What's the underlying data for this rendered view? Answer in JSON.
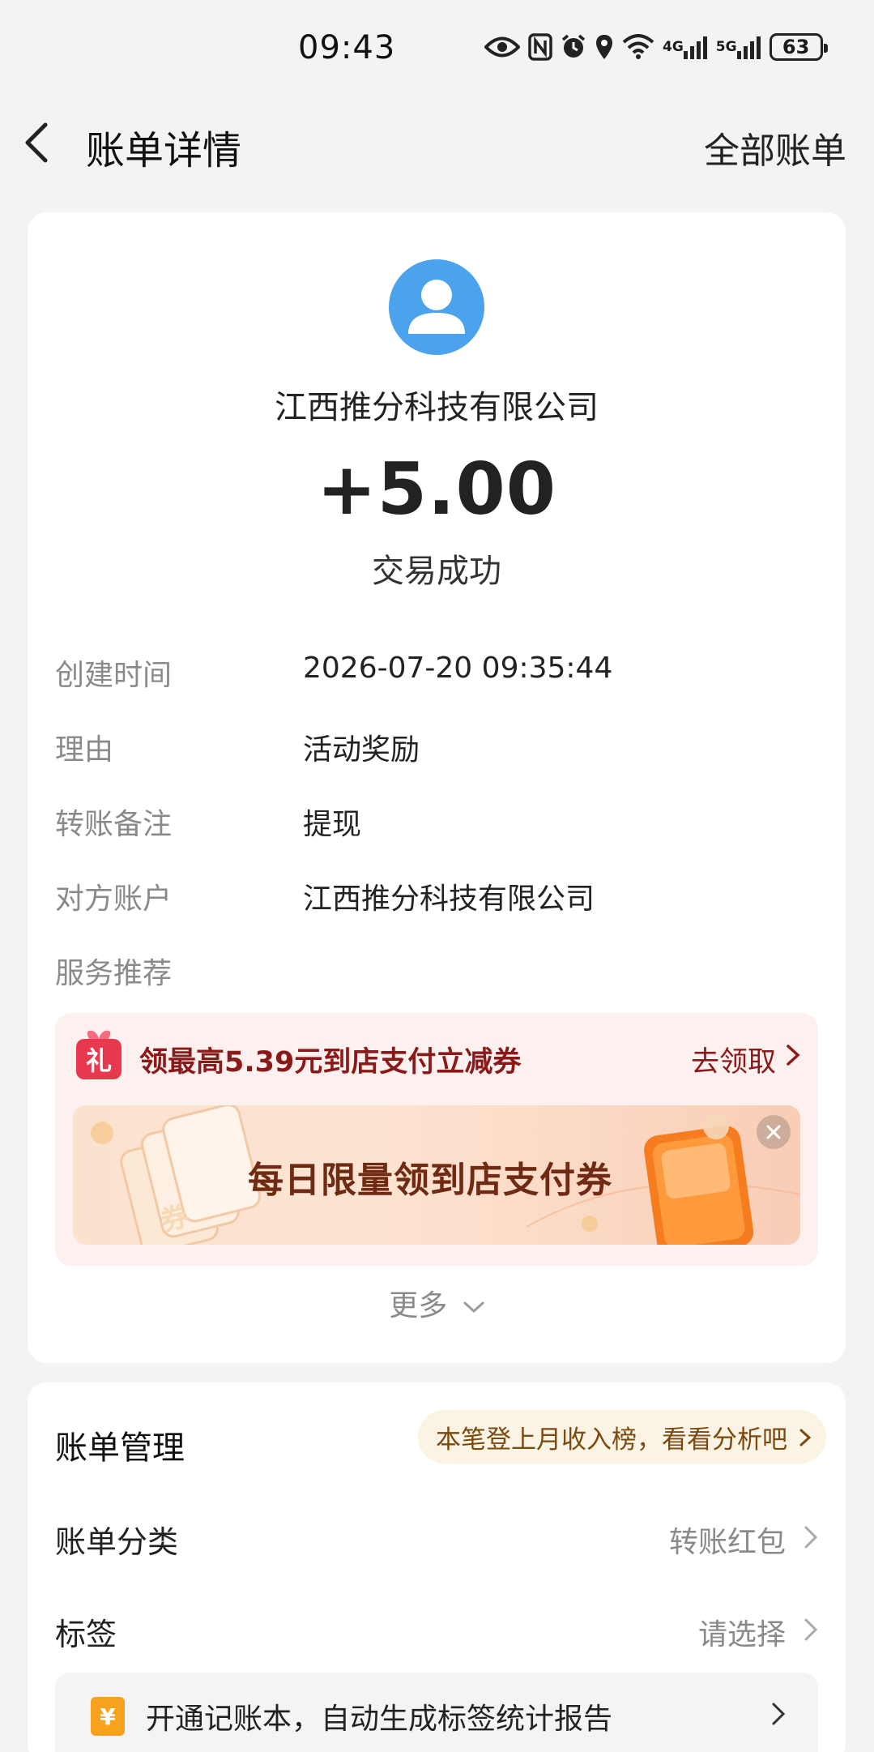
{
  "status_bar": {
    "time": "09:43",
    "net_4g": "4G",
    "net_5g": "5G",
    "battery": "63",
    "icons": [
      "eye-icon",
      "nfc-icon",
      "alarm-icon",
      "location-icon",
      "wifi-icon",
      "signal-4g-icon",
      "signal-5g-icon",
      "battery-icon"
    ]
  },
  "nav": {
    "title": "账单详情",
    "right_link": "全部账单"
  },
  "bill": {
    "merchant": "江西推分科技有限公司",
    "amount": "+5.00",
    "status": "交易成功",
    "rows": [
      {
        "label": "创建时间",
        "value": "2026-07-20 09:35:44"
      },
      {
        "label": "理由",
        "value": "活动奖励"
      },
      {
        "label": "转账备注",
        "value": "提现"
      },
      {
        "label": "对方账户",
        "value": "江西推分科技有限公司"
      },
      {
        "label": "服务推荐",
        "value": ""
      }
    ]
  },
  "promo": {
    "icon_char": "礼",
    "text": "领最高5.39元到店支付立减券",
    "link": "去领取",
    "banner_text": "每日限量领到店支付券",
    "banner_coupon_char": "券",
    "more": "更多"
  },
  "manage": {
    "title": "账单管理",
    "pill": "本笔登上月收入榜，看看分析吧",
    "category_label": "账单分类",
    "category_value": "转账红包",
    "tag_label": "标签",
    "tag_value": "请选择",
    "ledger_icon_char": "¥",
    "ledger_text": "开通记账本，自动生成标签统计报告"
  },
  "colors": {
    "accent_blue": "#4aa3ec",
    "promo_red": "#8a1a1a",
    "pill_text": "#7a4a10"
  }
}
